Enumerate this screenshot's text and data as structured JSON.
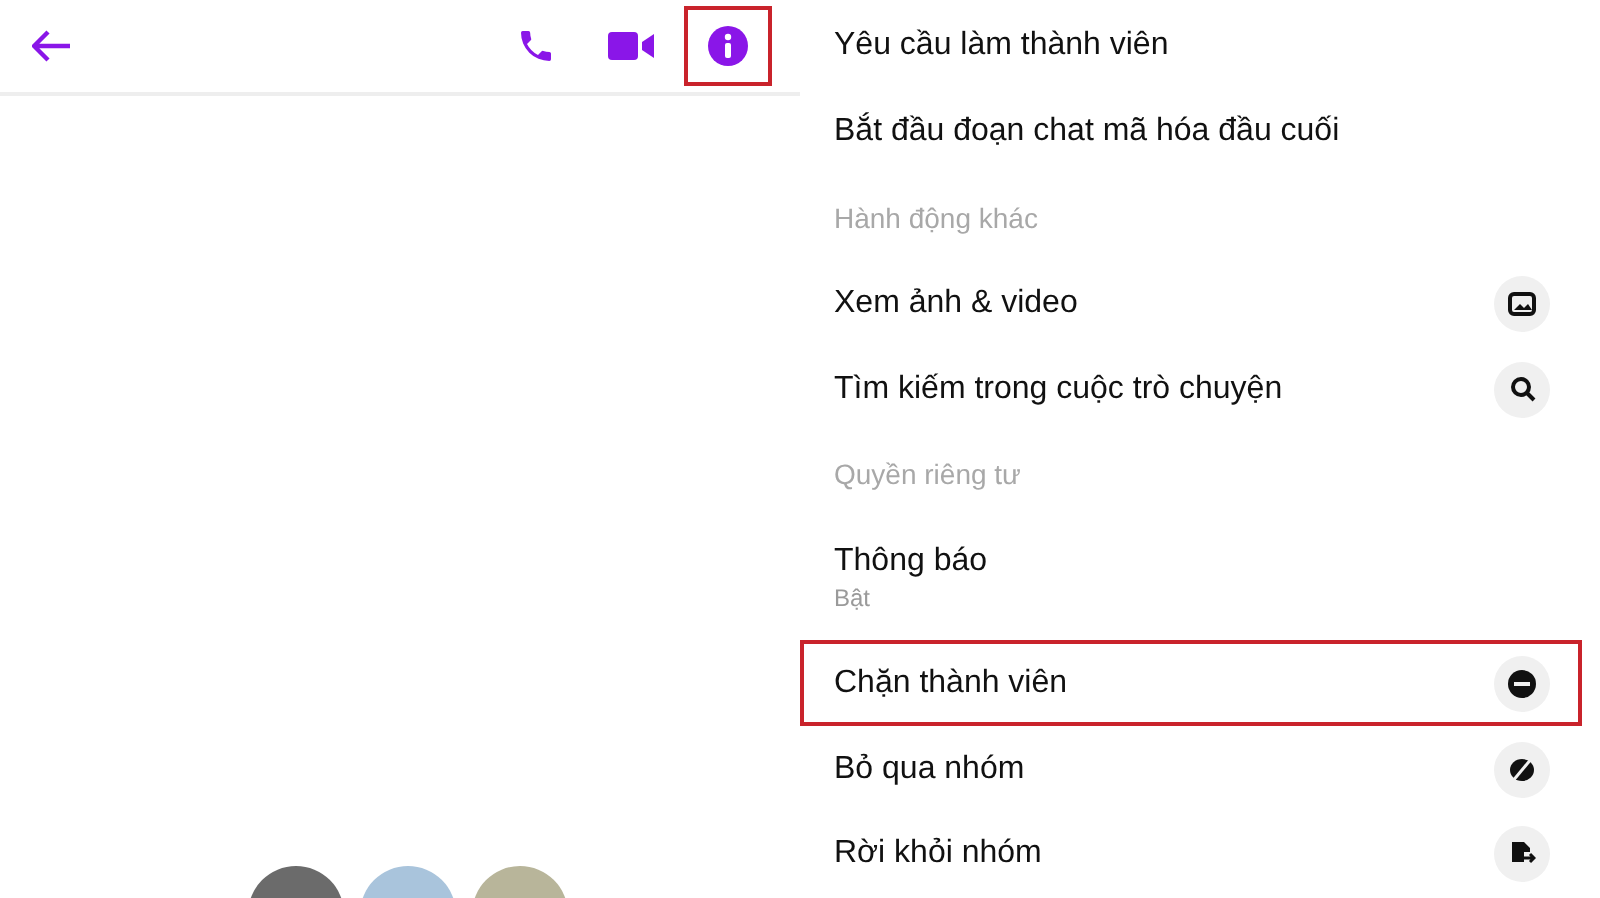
{
  "header": {
    "info_highlighted": true
  },
  "avatars": [
    {
      "color": "#6b6b6b"
    },
    {
      "color": "#a9c4dc"
    },
    {
      "color": "#b8b59a"
    }
  ],
  "menu": [
    {
      "kind": "plain",
      "label": "Yêu cầu làm thành viên",
      "highlighted": false
    },
    {
      "kind": "plain",
      "label": "Bắt đầu đoạn chat mã hóa đầu cuối",
      "highlighted": false
    },
    {
      "kind": "section",
      "label": "Hành động khác"
    },
    {
      "kind": "media",
      "label": "Xem ảnh & video",
      "highlighted": false
    },
    {
      "kind": "search",
      "label": "Tìm kiếm trong cuộc trò chuyện",
      "highlighted": false
    },
    {
      "kind": "section",
      "label": "Quyền riêng tư"
    },
    {
      "kind": "setting",
      "label": "Thông báo",
      "sublabel": "Bật"
    },
    {
      "kind": "block",
      "label": "Chặn thành viên",
      "highlighted": true
    },
    {
      "kind": "mute",
      "label": "Bỏ qua nhóm",
      "highlighted": false
    },
    {
      "kind": "leave",
      "label": "Rời khỏi nhóm",
      "highlighted": false
    }
  ]
}
